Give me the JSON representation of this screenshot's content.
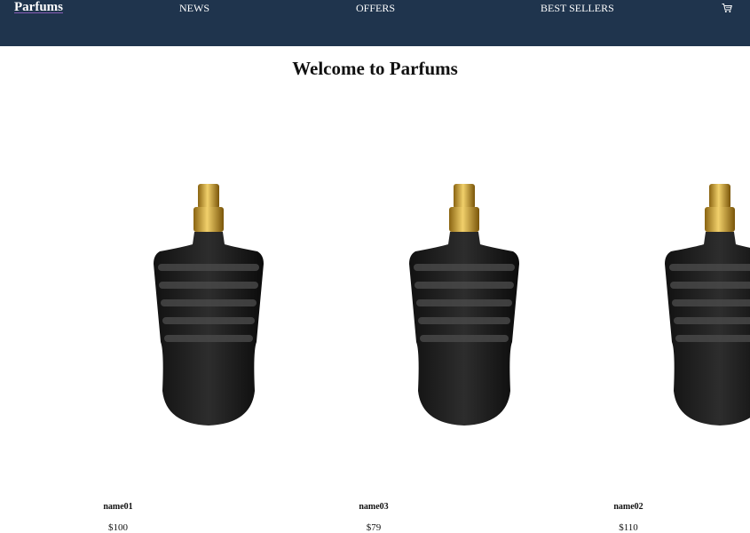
{
  "header": {
    "brand": "Parfums",
    "nav": [
      "NEWS",
      "OFFERS",
      "BEST SELLERS"
    ],
    "cart_icon": "shopping-cart-icon",
    "background_color": "#1f344d"
  },
  "main": {
    "title": "Welcome to Parfums",
    "products": [
      {
        "name": "name01",
        "price": "$100",
        "image": "perfume-bottle-black-gold"
      },
      {
        "name": "name03",
        "price": "$79",
        "image": "perfume-bottle-black-gold"
      },
      {
        "name": "name02",
        "price": "$110",
        "image": "perfume-bottle-black-gold"
      }
    ]
  }
}
